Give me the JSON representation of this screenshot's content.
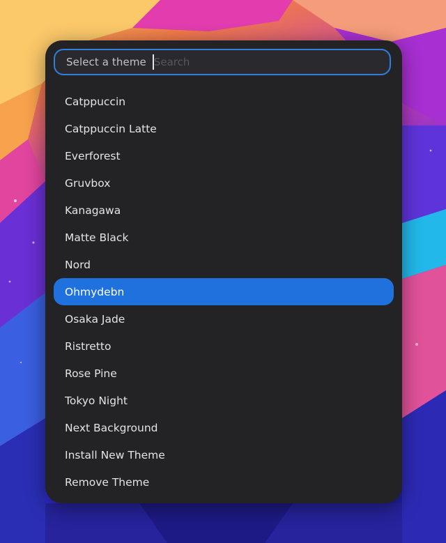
{
  "launcher": {
    "prompt": "Select a theme",
    "search_placeholder": "Search",
    "search_value": "",
    "selected_index": 7,
    "items": [
      {
        "label": "Catppuccin"
      },
      {
        "label": "Catppuccin Latte"
      },
      {
        "label": "Everforest"
      },
      {
        "label": "Gruvbox"
      },
      {
        "label": "Kanagawa"
      },
      {
        "label": "Matte Black"
      },
      {
        "label": "Nord"
      },
      {
        "label": "Ohmydebn"
      },
      {
        "label": "Osaka Jade"
      },
      {
        "label": "Ristretto"
      },
      {
        "label": "Rose Pine"
      },
      {
        "label": "Tokyo Night"
      },
      {
        "label": "Next Background"
      },
      {
        "label": "Install New Theme"
      },
      {
        "label": "Remove Theme"
      }
    ]
  },
  "colors": {
    "panel_bg": "#232326",
    "accent": "#1f72de",
    "search_border": "#2f7fdc",
    "text": "#e4e4e6"
  }
}
